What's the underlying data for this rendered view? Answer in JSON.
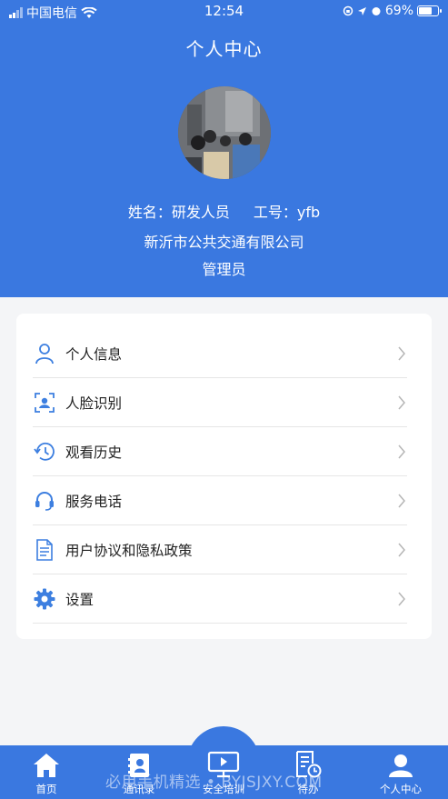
{
  "status_bar": {
    "carrier": "中国电信",
    "time": "12:54",
    "battery": "69%",
    "battery_level": 0.69
  },
  "header": {
    "title": "个人中心"
  },
  "profile": {
    "name_text": "姓名：研发人员",
    "id_text": "工号：yfb",
    "company": "新沂市公共交通有限公司",
    "role": "管理员"
  },
  "menu": [
    {
      "label": "个人信息",
      "icon": "person-icon"
    },
    {
      "label": "人脸识别",
      "icon": "face-scan-icon"
    },
    {
      "label": "观看历史",
      "icon": "history-icon"
    },
    {
      "label": "服务电话",
      "icon": "headset-icon"
    },
    {
      "label": "用户协议和隐私政策",
      "icon": "document-icon"
    },
    {
      "label": "设置",
      "icon": "gear-icon"
    }
  ],
  "tabs": [
    {
      "label": "首页",
      "icon": "home-icon"
    },
    {
      "label": "通讯录",
      "icon": "contacts-icon"
    },
    {
      "label": "安全培训",
      "icon": "training-icon"
    },
    {
      "label": "待办",
      "icon": "todo-icon"
    },
    {
      "label": "个人中心",
      "icon": "profile-icon"
    }
  ],
  "watermark": "必用手机精选 • BYJSJXY.COM",
  "colors": {
    "brand_blue": "#3a78e0",
    "icon_blue": "#3d7fe0",
    "background": "#f4f5f7"
  }
}
